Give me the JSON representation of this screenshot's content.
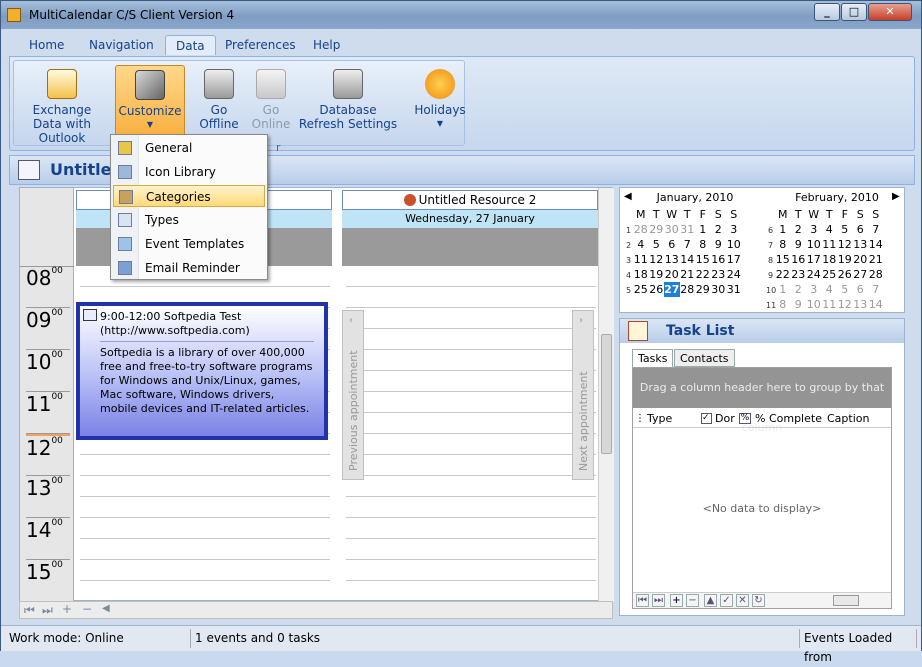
{
  "window": {
    "title": "MultiCalendar C/S Client Version 4"
  },
  "menu_tabs": [
    "Home",
    "Navigation",
    "Data",
    "Preferences",
    "Help"
  ],
  "active_tab": "Data",
  "ribbon": {
    "exchange": "Exchange Data with Outlook",
    "customize": "Customize",
    "offline": "Go Offline",
    "online": "Go Online",
    "refresh": "Database Refresh Settings",
    "holidays": "Holidays",
    "group_label": "r"
  },
  "calendar_header": {
    "title": "Untitled"
  },
  "customize_menu": [
    {
      "label": "General",
      "icon": "general-icon"
    },
    {
      "label": "Icon Library",
      "icon": "icon-library-icon"
    },
    {
      "label": "Categories",
      "icon": "categories-icon"
    },
    {
      "label": "Types",
      "icon": "types-icon"
    },
    {
      "label": "Event Templates",
      "icon": "event-templates-icon"
    },
    {
      "label": "Email Reminder",
      "icon": "email-reminder-icon"
    }
  ],
  "scheduler": {
    "hours": [
      "08",
      "09",
      "10",
      "11",
      "12",
      "13",
      "14",
      "15"
    ],
    "minutes_label": "00",
    "resource2": {
      "name": "Untitled Resource 2",
      "date": "Wednesday, 27 January"
    },
    "appointment": {
      "time_title": "9:00-12:00 Softpedia Test",
      "url": "(http://www.softpedia.com)",
      "body": "Softpedia is a library of over 400,000 free and free-to-try software programs for Windows and Unix/Linux, games, Mac software, Windows drivers, mobile devices and IT-related articles."
    },
    "prev_appointment": "Previous appointment",
    "next_appointment": "Next appointment"
  },
  "mini_calendars": [
    {
      "title": "January, 2010",
      "dow": [
        "M",
        "T",
        "W",
        "T",
        "F",
        "S",
        "S"
      ],
      "weeks": [
        {
          "wk": "1",
          "days": [
            "28",
            "29",
            "30",
            "31",
            "1",
            "2",
            "3"
          ],
          "other": [
            0,
            1,
            2,
            3
          ]
        },
        {
          "wk": "2",
          "days": [
            "4",
            "5",
            "6",
            "7",
            "8",
            "9",
            "10"
          ],
          "other": []
        },
        {
          "wk": "3",
          "days": [
            "11",
            "12",
            "13",
            "14",
            "15",
            "16",
            "17"
          ],
          "other": []
        },
        {
          "wk": "4",
          "days": [
            "18",
            "19",
            "20",
            "21",
            "22",
            "23",
            "24"
          ],
          "other": []
        },
        {
          "wk": "5",
          "days": [
            "25",
            "26",
            "27",
            "28",
            "29",
            "30",
            "31"
          ],
          "other": [],
          "today": 2
        }
      ]
    },
    {
      "title": "February, 2010",
      "dow": [
        "M",
        "T",
        "W",
        "T",
        "F",
        "S",
        "S"
      ],
      "weeks": [
        {
          "wk": "6",
          "days": [
            "1",
            "2",
            "3",
            "4",
            "5",
            "6",
            "7"
          ],
          "other": []
        },
        {
          "wk": "7",
          "days": [
            "8",
            "9",
            "10",
            "11",
            "12",
            "13",
            "14"
          ],
          "other": []
        },
        {
          "wk": "8",
          "days": [
            "15",
            "16",
            "17",
            "18",
            "19",
            "20",
            "21"
          ],
          "other": []
        },
        {
          "wk": "9",
          "days": [
            "22",
            "23",
            "24",
            "25",
            "26",
            "27",
            "28"
          ],
          "other": []
        },
        {
          "wk": "10",
          "days": [
            "1",
            "2",
            "3",
            "4",
            "5",
            "6",
            "7"
          ],
          "other": [
            0,
            1,
            2,
            3,
            4,
            5,
            6
          ]
        },
        {
          "wk": "11",
          "days": [
            "8",
            "9",
            "10",
            "11",
            "12",
            "13",
            "14"
          ],
          "other": [
            0,
            1,
            2,
            3,
            4,
            5,
            6
          ]
        }
      ]
    }
  ],
  "task_list": {
    "title": "Task List",
    "tabs": [
      "Tasks",
      "Contacts"
    ],
    "group_panel": "Drag a column header here to group by that column",
    "columns": [
      "Type",
      "Dor",
      "% Complete",
      "Caption"
    ],
    "empty": "<No data to display>"
  },
  "status": {
    "mode": "Work mode: Online",
    "events": "1 events and 0 tasks",
    "loaded": "Events Loaded from"
  }
}
